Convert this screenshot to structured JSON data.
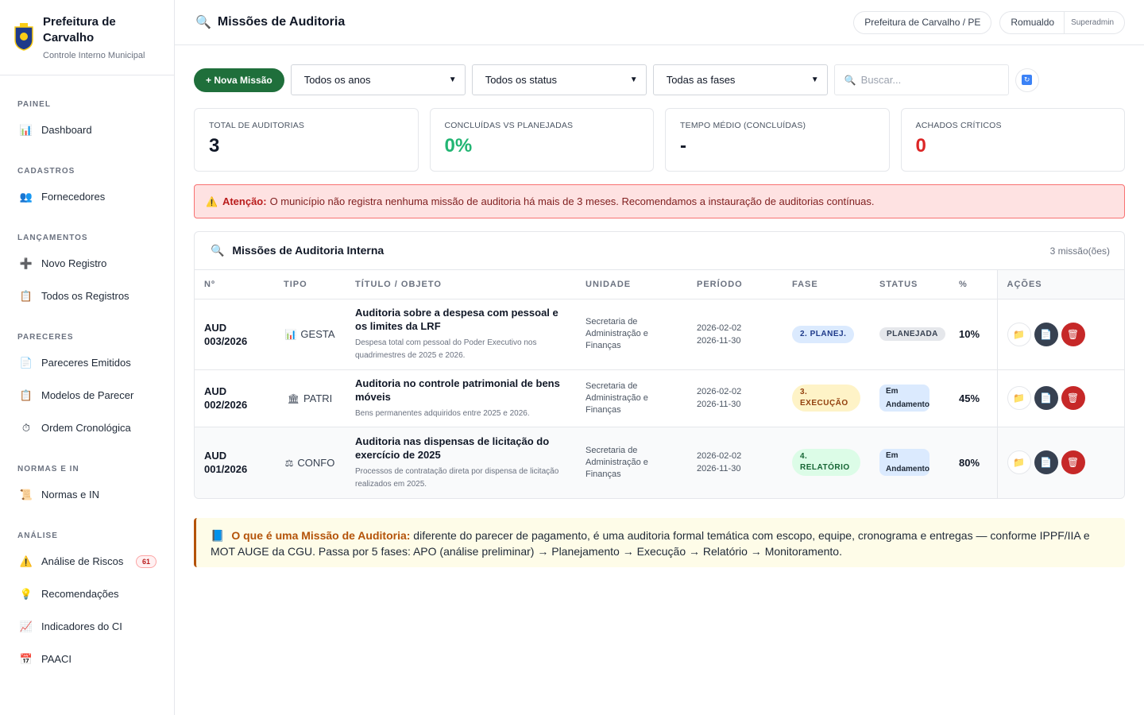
{
  "brand": {
    "title": "Prefeitura de Carvalho",
    "subtitle": "Controle Interno Municipal"
  },
  "sidebar": {
    "sections": [
      {
        "heading": "PAINEL",
        "items": [
          {
            "label": "Dashboard",
            "icon": "chart-icon"
          }
        ]
      },
      {
        "heading": "CADASTROS",
        "items": [
          {
            "label": "Fornecedores",
            "icon": "users-icon"
          }
        ]
      },
      {
        "heading": "LANÇAMENTOS",
        "items": [
          {
            "label": "Novo Registro",
            "icon": "plus-icon"
          },
          {
            "label": "Todos os Registros",
            "icon": "clipboard-icon"
          }
        ]
      },
      {
        "heading": "PARECERES",
        "items": [
          {
            "label": "Pareceres Emitidos",
            "icon": "document-icon"
          },
          {
            "label": "Modelos de Parecer",
            "icon": "clipboard-icon"
          },
          {
            "label": "Ordem Cronológica",
            "icon": "stopwatch-icon"
          }
        ]
      },
      {
        "heading": "NORMAS E IN",
        "items": [
          {
            "label": "Normas e IN",
            "icon": "scroll-icon"
          }
        ]
      },
      {
        "heading": "ANÁLISE",
        "items": [
          {
            "label": "Análise de Riscos",
            "icon": "warning-icon",
            "badge": "61"
          },
          {
            "label": "Recomendações",
            "icon": "lightbulb-icon"
          },
          {
            "label": "Indicadores do CI",
            "icon": "trend-icon"
          },
          {
            "label": "PAACI",
            "icon": "calendar-icon"
          }
        ]
      }
    ]
  },
  "header": {
    "title": "Missões de Auditoria",
    "org": "Prefeitura de Carvalho / PE",
    "user": "Romualdo",
    "role": "Superadmin"
  },
  "filters": {
    "new_button": "+ Nova Missão",
    "year": "Todos os anos",
    "status": "Todos os status",
    "phase": "Todas as fases",
    "search_placeholder": "Buscar..."
  },
  "stats": [
    {
      "label": "TOTAL DE AUDITORIAS",
      "value": "3",
      "color": "#111827"
    },
    {
      "label": "CONCLUÍDAS VS PLANEJADAS",
      "value": "0%",
      "color": "#22b573"
    },
    {
      "label": "TEMPO MÉDIO (CONCLUÍDAS)",
      "value": "-",
      "color": "#111827"
    },
    {
      "label": "ACHADOS CRÍTICOS",
      "value": "0",
      "color": "#dc2626"
    }
  ],
  "alert": {
    "strong": "Atenção:",
    "text": "O município não registra nenhuma missão de auditoria há mais de 3 meses. Recomendamos a instauração de auditorias contínuas."
  },
  "table": {
    "title": "Missões de Auditoria Interna",
    "count": "3 missão(ões)",
    "columns": [
      "Nº",
      "TIPO",
      "TÍTULO / OBJETO",
      "UNIDADE",
      "PERÍODO",
      "FASE",
      "STATUS",
      "%",
      "AÇÕES"
    ],
    "rows": [
      {
        "num1": "AUD",
        "num2": "003/2026",
        "tipo_icon": "📊",
        "tipo": "GESTA",
        "title": "Auditoria sobre a despesa com pessoal e os limites da LRF",
        "desc": "Despesa total com pessoal do Poder Executivo nos quadrimestres de 2025 e 2026.",
        "unit": "Secretaria de Administração e Finanças",
        "start": "2026-02-02",
        "end": "2026-11-30",
        "fase": "2. PLANEJ.",
        "status": "PLANEJADA",
        "pct": "10%"
      },
      {
        "num1": "AUD",
        "num2": "002/2026",
        "tipo_icon": "🏛",
        "tipo": "PATRI",
        "title": "Auditoria no controle patrimonial de bens móveis",
        "desc": "Bens permanentes adquiridos entre 2025 e 2026.",
        "unit": "Secretaria de Administração e Finanças",
        "start": "2026-02-02",
        "end": "2026-11-30",
        "fase": "3. EXECUÇÃO",
        "status": "Em Andamento",
        "pct": "45%"
      },
      {
        "num1": "AUD",
        "num2": "001/2026",
        "tipo_icon": "⚖",
        "tipo": "CONFO",
        "title": "Auditoria nas dispensas de licitação do exercício de 2025",
        "desc": "Processos de contratação direta por dispensa de licitação realizados em 2025.",
        "unit": "Secretaria de Administração e Finanças",
        "start": "2026-02-02",
        "end": "2026-11-30",
        "fase": "4. RELATÓRIO",
        "status": "Em Andamento",
        "pct": "80%"
      }
    ]
  },
  "info": {
    "strong": "O que é uma Missão de Auditoria:",
    "text": "diferente do parecer de pagamento, é uma auditoria formal temática com escopo, equipe, cronograma e entregas — conforme IPPF/IIA e MOT AUGE da CGU. Passa por 5 fases: APO (análise preliminar) → Planejamento → Execução → Relatório → Monitoramento."
  }
}
